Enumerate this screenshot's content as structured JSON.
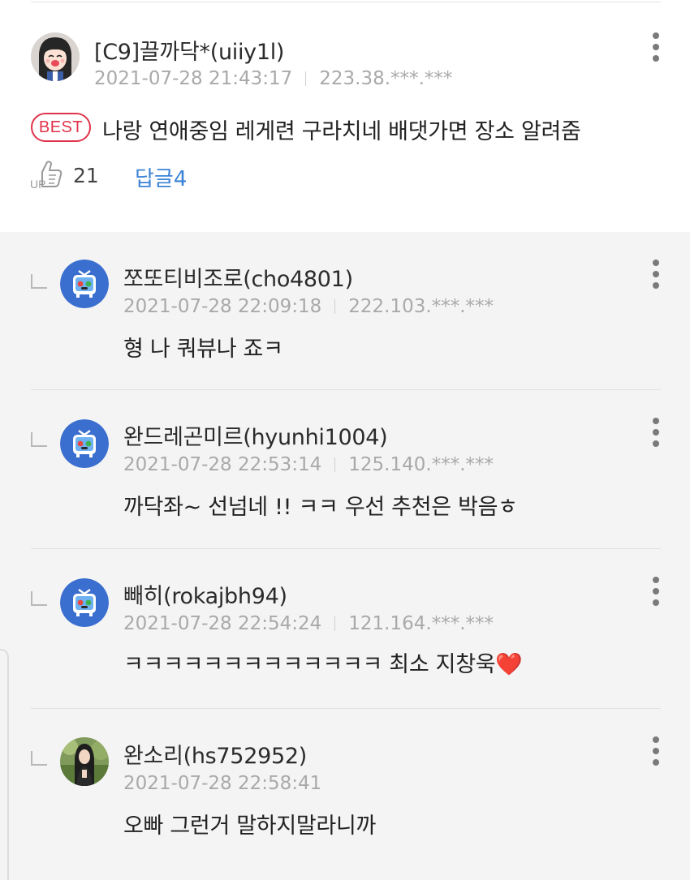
{
  "main_comment": {
    "author": "[C9]끌까닥*(uiiy1l)",
    "date": "2021-07-28 21:43:17",
    "ip": "223.38.***.***",
    "badge": "BEST",
    "text": "나랑 연애중임 레게련 구라치네 배댓가면 장소 알려줌",
    "up_icon": "thumbs-up-icon",
    "up_count": "21",
    "reply_link": "답글4"
  },
  "replies": [
    {
      "author": "쪼또티비조로(cho4801)",
      "date": "2021-07-28 22:09:18",
      "ip": "222.103.***.***",
      "text": "형 나 쿼뷰나 죠ㅋ",
      "avatar": "tv-character-icon"
    },
    {
      "author": "완드레곤미르(hyunhi1004)",
      "date": "2021-07-28 22:53:14",
      "ip": "125.140.***.***",
      "text": "까닥좌~ 선넘네 !! ㅋㅋ 우선 추천은 박음ㅎ",
      "avatar": "tv-character-icon"
    },
    {
      "author": "빼히(rokajbh94)",
      "date": "2021-07-28 22:54:24",
      "ip": "121.164.***.***",
      "text": "ㅋㅋㅋㅋㅋㅋㅋㅋㅋㅋㅋㅋㅋ 최소 지창욱❤️",
      "avatar": "tv-character-icon"
    },
    {
      "author": "완소리(hs752952)",
      "date": "2021-07-28 22:58:41",
      "ip": "",
      "text": "오빠 그런거 말하지말라니까",
      "avatar": "user-photo"
    }
  ],
  "colors": {
    "accent_red": "#e0334b",
    "link_blue": "#3b82d6",
    "meta_gray": "#a9a9a9",
    "reply_bg": "#f4f4f4",
    "tv_avatar_blue": "#3a6fd0"
  }
}
